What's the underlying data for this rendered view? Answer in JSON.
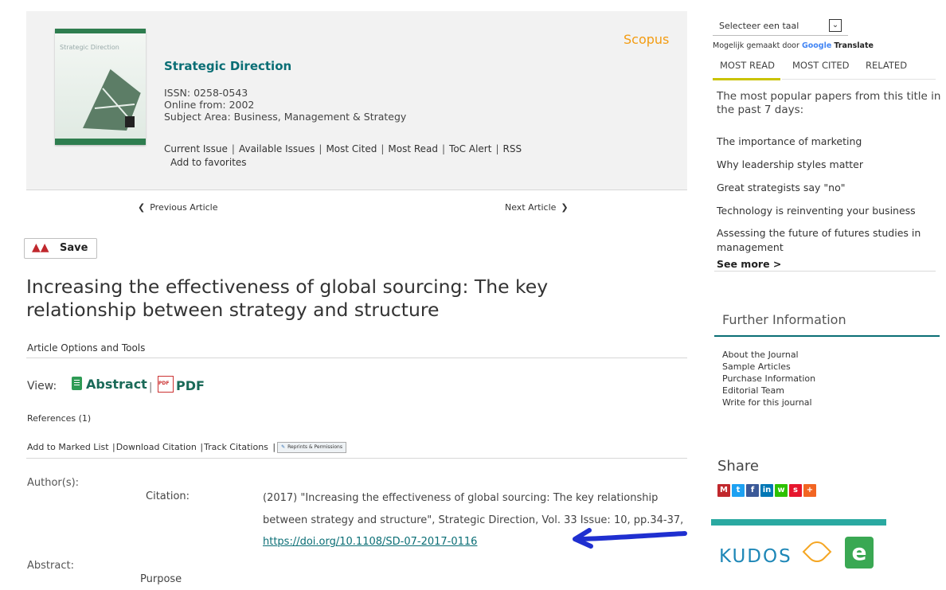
{
  "journal": {
    "cover_title": "Strategic Direction",
    "title": "Strategic Direction",
    "issn": "ISSN: 0258-0543",
    "online_from": "Online from: 2002",
    "subject_area": "Subject Area: Business, Management & Strategy",
    "links": [
      "Current Issue",
      "Available Issues",
      "Most Cited",
      "Most Read",
      "ToC Alert",
      "RSS"
    ],
    "add_favorites": "Add to favorites",
    "scopus": "Scopus"
  },
  "nav": {
    "previous": "Previous Article",
    "next": "Next Article"
  },
  "save_button": "Save",
  "article": {
    "title": "Increasing the effectiveness of global sourcing: The key relationship between strategy and structure",
    "options_label": "Article Options and Tools",
    "view_label": "View:",
    "abstract_link": "Abstract",
    "view_separator": "|",
    "pdf_link": "PDF",
    "references": "References (1)",
    "tools": {
      "add_marked": "Add to Marked List",
      "download_citation": "Download Citation",
      "track_citations": "Track Citations",
      "reprints": "Reprints & Permissions"
    },
    "authors_label": "Author(s):",
    "citation_label": "Citation:",
    "citation_text": "(2017) \"Increasing the effectiveness of global sourcing: The key relationship between strategy and structure\", Strategic Direction, Vol. 33 Issue: 10, pp.34-37, ",
    "doi": "https://doi.org/10.1108/SD-07-2017-0116",
    "abstract_label": "Abstract:",
    "purpose_label": "Purpose"
  },
  "sidebar": {
    "language_select": "Selecteer een taal",
    "powered_prefix": "Mogelijk gemaakt door",
    "powered_google": "Google",
    "powered_translate": "Translate",
    "tabs": [
      "MOST READ",
      "MOST CITED",
      "RELATED"
    ],
    "popular_intro": "The most popular papers from this title in the past 7 days:",
    "popular_items": [
      "The importance of marketing",
      "Why leadership styles matter",
      "Great strategists say \"no\"",
      "Technology is reinventing your business",
      "Assessing the future of futures studies in management"
    ],
    "see_more": "See more >",
    "further_info_title": "Further Information",
    "further_links": [
      "About the Journal",
      "Sample Articles",
      "Purchase Information",
      "Editorial Team",
      "Write for this journal"
    ],
    "share_label": "Share",
    "share_icons": [
      {
        "name": "mendeley-icon",
        "glyph": "M",
        "color": "#c0282d"
      },
      {
        "name": "twitter-icon",
        "glyph": "t",
        "color": "#1da1f2"
      },
      {
        "name": "facebook-icon",
        "glyph": "f",
        "color": "#3b5998"
      },
      {
        "name": "linkedin-icon",
        "glyph": "in",
        "color": "#0077b5"
      },
      {
        "name": "wechat-icon",
        "glyph": "w",
        "color": "#2dc100"
      },
      {
        "name": "weibo-icon",
        "glyph": "s",
        "color": "#e6162d"
      },
      {
        "name": "more-share-icon",
        "glyph": "+",
        "color": "#f26522"
      }
    ],
    "kudos": "KUDOS"
  },
  "colors": {
    "teal": "#0a6e75",
    "scopus_orange": "#f39c12",
    "tab_underline": "#c9c300",
    "annotation_arrow": "#1f2fd0"
  }
}
